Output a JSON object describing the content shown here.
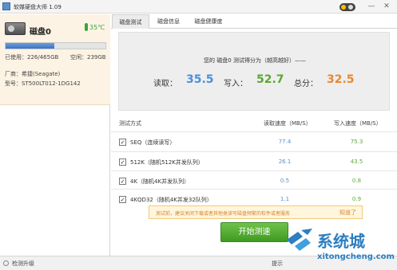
{
  "window": {
    "title": "软媒硬盘大师 1.09",
    "controls": [
      "minimize-icon",
      "close-icon"
    ]
  },
  "left_panel": {
    "disk_name": "磁盘0",
    "temperature": "35℃",
    "usage_fraction": 0.487,
    "used": "已使用：226/465GB",
    "free": "空闲：239GB",
    "vendor": "厂商：希捷(Seagate)",
    "model": "型号：ST500LT012-1DG142"
  },
  "tabs": [
    {
      "label": "磁盘测试",
      "active": true
    },
    {
      "label": "磁盘信息",
      "active": false
    },
    {
      "label": "磁盘健康度",
      "active": false
    }
  ],
  "score": {
    "title": "您的 磁盘0 测试得分为（越高越好）——",
    "read_label": "读取：",
    "read_value": "35.5",
    "write_label": "写入：",
    "write_value": "52.7",
    "total_label": "总分：",
    "total_value": "32.5",
    "colors": {
      "read": "#4a90d9",
      "write": "#5aa832",
      "total": "#e8892e"
    }
  },
  "table": {
    "headers": [
      "测试方式",
      "读取速度（MB/S）",
      "写入速度（MB/S）"
    ],
    "rows": [
      {
        "name": "SEQ（连续读写）",
        "read": "77.4",
        "write": "75.3",
        "checked": true
      },
      {
        "name": "512K（随机512K并发队列）",
        "read": "26.1",
        "write": "43.5",
        "checked": true
      },
      {
        "name": "4K（随机4K并发队列）",
        "read": "0.5",
        "write": "0.8",
        "checked": true
      },
      {
        "name": "4KQD32（随机4K并发32队列）",
        "read": "1.1",
        "write": "0.9",
        "checked": true
      }
    ]
  },
  "tip": {
    "text": "测试前，建议关闭下载或者其他类读写磁盘频繁的软件或者服务",
    "link": "知道了"
  },
  "start_button": "开始测速",
  "statusbar": {
    "update": "检测升级",
    "hint": "提示"
  },
  "watermark": {
    "main": "系统城",
    "sub": "xitongcheng.com"
  }
}
